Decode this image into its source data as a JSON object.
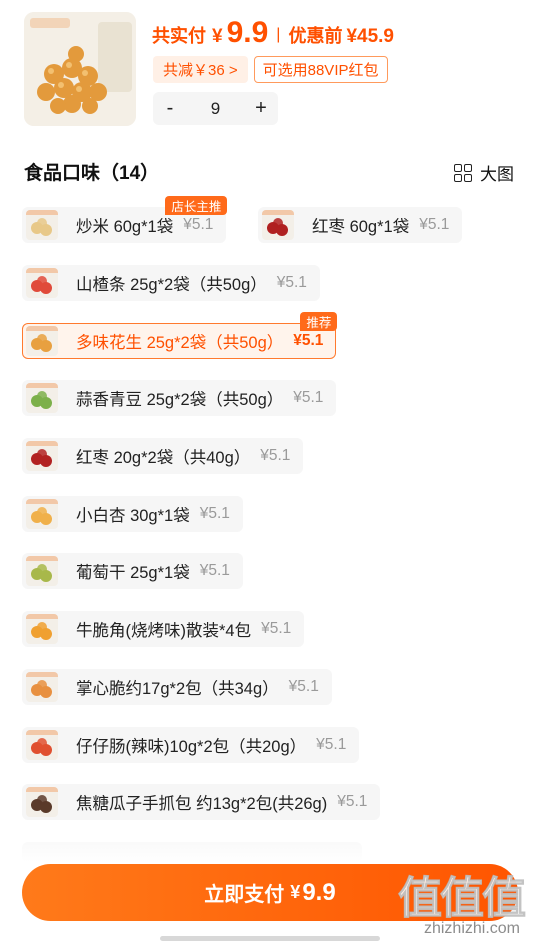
{
  "header": {
    "pay_label": "共实付",
    "currency": "¥",
    "pay_amount": "9.9",
    "separator": "|",
    "orig_label": "优惠前",
    "orig_price": "¥45.9",
    "save_tag": "共减￥36 >",
    "vip_tag": "可选用88VIP红包",
    "quantity": "9",
    "minus": "-",
    "plus": "+"
  },
  "section": {
    "title": "食品口味（14）",
    "view_label": "大图",
    "view_icon": "grid-icon"
  },
  "options": [
    {
      "label": "炒米 60g*1袋",
      "price": "¥5.1",
      "badge": "店长主推",
      "selected": false,
      "thumb_color": "#e8c888"
    },
    {
      "label": "红枣 60g*1袋",
      "price": "¥5.1",
      "badge": "",
      "selected": false,
      "thumb_color": "#b02020"
    },
    {
      "label": "山楂条 25g*2袋（共50g）",
      "price": "¥5.1",
      "badge": "",
      "selected": false,
      "thumb_color": "#e04a3a"
    },
    {
      "label": "多味花生 25g*2袋（共50g）",
      "price": "¥5.1",
      "badge": "推荐",
      "selected": true,
      "thumb_color": "#e8a040"
    },
    {
      "label": "蒜香青豆 25g*2袋（共50g）",
      "price": "¥5.1",
      "badge": "",
      "selected": false,
      "thumb_color": "#7cb04a"
    },
    {
      "label": "红枣 20g*2袋（共40g）",
      "price": "¥5.1",
      "badge": "",
      "selected": false,
      "thumb_color": "#b22222"
    },
    {
      "label": "小白杏 30g*1袋",
      "price": "¥5.1",
      "badge": "",
      "selected": false,
      "thumb_color": "#f0b04a"
    },
    {
      "label": "葡萄干 25g*1袋",
      "price": "¥5.1",
      "badge": "",
      "selected": false,
      "thumb_color": "#a8b84a"
    },
    {
      "label": "牛脆角(烧烤味)散装*4包",
      "price": "¥5.1",
      "badge": "",
      "selected": false,
      "thumb_color": "#f0a030"
    },
    {
      "label": "掌心脆约17g*2包（共34g）",
      "price": "¥5.1",
      "badge": "",
      "selected": false,
      "thumb_color": "#e89040"
    },
    {
      "label": "仔仔肠(辣味)10g*2包（共20g）",
      "price": "¥5.1",
      "badge": "",
      "selected": false,
      "thumb_color": "#e05030"
    },
    {
      "label": "焦糖瓜子手抓包 约13g*2包(共26g)",
      "price": "¥5.1",
      "badge": "",
      "selected": false,
      "thumb_color": "#5a3a2a"
    }
  ],
  "pay_button": {
    "label": "立即支付",
    "currency": "¥",
    "amount": "9.9"
  },
  "watermark": {
    "main": "值值值",
    "sub": "zhizhizhi.com"
  },
  "colors": {
    "accent": "#ff5000",
    "selected_bg": "#fff4ec",
    "option_bg": "#f6f6f6"
  }
}
